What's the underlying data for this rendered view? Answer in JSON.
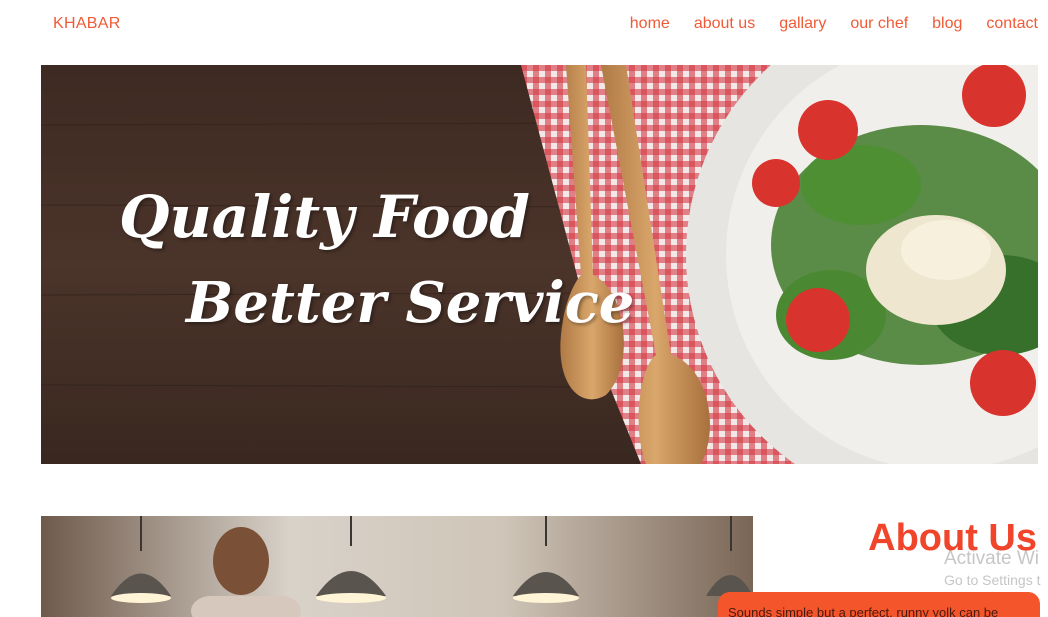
{
  "navbar": {
    "brand": "KHABAR",
    "links": [
      "home",
      "about us",
      "gallary",
      "our chef",
      "blog",
      "contact"
    ]
  },
  "hero": {
    "line1": "Quality Food",
    "line2": "Better Service"
  },
  "about": {
    "title": "About Us",
    "card_text": "Sounds simple but a perfect, runny yolk can be"
  },
  "os_watermark": {
    "line1": "Activate Wi",
    "line2": "Go to Settings t"
  },
  "colors": {
    "accent": "#f05a36",
    "card": "#f5552a"
  }
}
